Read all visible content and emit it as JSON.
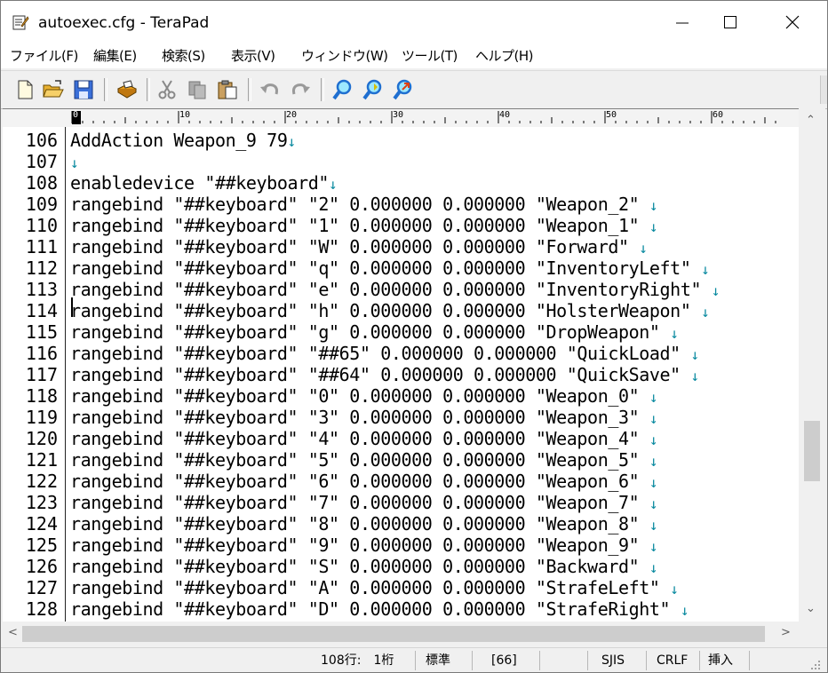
{
  "window": {
    "title": "autoexec.cfg - TeraPad"
  },
  "menu": [
    "ファイル(F)",
    "編集(E)",
    "検索(S)",
    "表示(V)",
    "ウィンドウ(W)",
    "ツール(T)",
    "ヘルプ(H)"
  ],
  "toolbar": {
    "buttons": [
      "new-file-icon",
      "open-folder-icon",
      "save-icon",
      "print-icon",
      "cut-icon",
      "copy-icon",
      "paste-icon",
      "undo-icon",
      "redo-icon",
      "find-icon",
      "find-next-icon",
      "find-prev-icon"
    ]
  },
  "ruler": {
    "labels": [
      "0",
      "10",
      "20",
      "30",
      "40",
      "50",
      "60"
    ]
  },
  "editor": {
    "lines": [
      {
        "num": "106",
        "text": "AddAction Weapon_9 79",
        "mark": "↓"
      },
      {
        "num": "107",
        "text": "",
        "mark": "↓"
      },
      {
        "num": "108",
        "text": "enabledevice \"##keyboard\"",
        "mark": "↓"
      },
      {
        "num": "109",
        "text": "rangebind \"##keyboard\" \"2\" 0.000000 0.000000 \"Weapon_2\" ",
        "mark": "↓"
      },
      {
        "num": "110",
        "text": "rangebind \"##keyboard\" \"1\" 0.000000 0.000000 \"Weapon_1\" ",
        "mark": "↓"
      },
      {
        "num": "111",
        "text": "rangebind \"##keyboard\" \"W\" 0.000000 0.000000 \"Forward\" ",
        "mark": "↓"
      },
      {
        "num": "112",
        "text": "rangebind \"##keyboard\" \"q\" 0.000000 0.000000 \"InventoryLeft\" ",
        "mark": "↓"
      },
      {
        "num": "113",
        "text": "rangebind \"##keyboard\" \"e\" 0.000000 0.000000 \"InventoryRight\" ",
        "mark": "↓"
      },
      {
        "num": "114",
        "text": "rangebind \"##keyboard\" \"h\" 0.000000 0.000000 \"HolsterWeapon\" ",
        "mark": "↓"
      },
      {
        "num": "115",
        "text": "rangebind \"##keyboard\" \"g\" 0.000000 0.000000 \"DropWeapon\" ",
        "mark": "↓"
      },
      {
        "num": "116",
        "text": "rangebind \"##keyboard\" \"##65\" 0.000000 0.000000 \"QuickLoad\" ",
        "mark": "↓"
      },
      {
        "num": "117",
        "text": "rangebind \"##keyboard\" \"##64\" 0.000000 0.000000 \"QuickSave\" ",
        "mark": "↓"
      },
      {
        "num": "118",
        "text": "rangebind \"##keyboard\" \"0\" 0.000000 0.000000 \"Weapon_0\" ",
        "mark": "↓"
      },
      {
        "num": "119",
        "text": "rangebind \"##keyboard\" \"3\" 0.000000 0.000000 \"Weapon_3\" ",
        "mark": "↓"
      },
      {
        "num": "120",
        "text": "rangebind \"##keyboard\" \"4\" 0.000000 0.000000 \"Weapon_4\" ",
        "mark": "↓"
      },
      {
        "num": "121",
        "text": "rangebind \"##keyboard\" \"5\" 0.000000 0.000000 \"Weapon_5\" ",
        "mark": "↓"
      },
      {
        "num": "122",
        "text": "rangebind \"##keyboard\" \"6\" 0.000000 0.000000 \"Weapon_6\" ",
        "mark": "↓"
      },
      {
        "num": "123",
        "text": "rangebind \"##keyboard\" \"7\" 0.000000 0.000000 \"Weapon_7\" ",
        "mark": "↓"
      },
      {
        "num": "124",
        "text": "rangebind \"##keyboard\" \"8\" 0.000000 0.000000 \"Weapon_8\" ",
        "mark": "↓"
      },
      {
        "num": "125",
        "text": "rangebind \"##keyboard\" \"9\" 0.000000 0.000000 \"Weapon_9\" ",
        "mark": "↓"
      },
      {
        "num": "126",
        "text": "rangebind \"##keyboard\" \"S\" 0.000000 0.000000 \"Backward\" ",
        "mark": "↓"
      },
      {
        "num": "127",
        "text": "rangebind \"##keyboard\" \"A\" 0.000000 0.000000 \"StrafeLeft\" ",
        "mark": "↓"
      },
      {
        "num": "128",
        "text": "rangebind \"##keyboard\" \"D\" 0.000000 0.000000 \"StrafeRight\" ",
        "mark": "↓"
      }
    ]
  },
  "status": {
    "position": "108行:　1桁",
    "mode": "標準",
    "char_code": "[66]",
    "encoding": "SJIS",
    "line_ending": "CRLF",
    "insert_mode": "挿入"
  },
  "colors": {
    "line_end_mark": "#0a8aa0",
    "selection_icon_blue": "#1f6fd0"
  }
}
